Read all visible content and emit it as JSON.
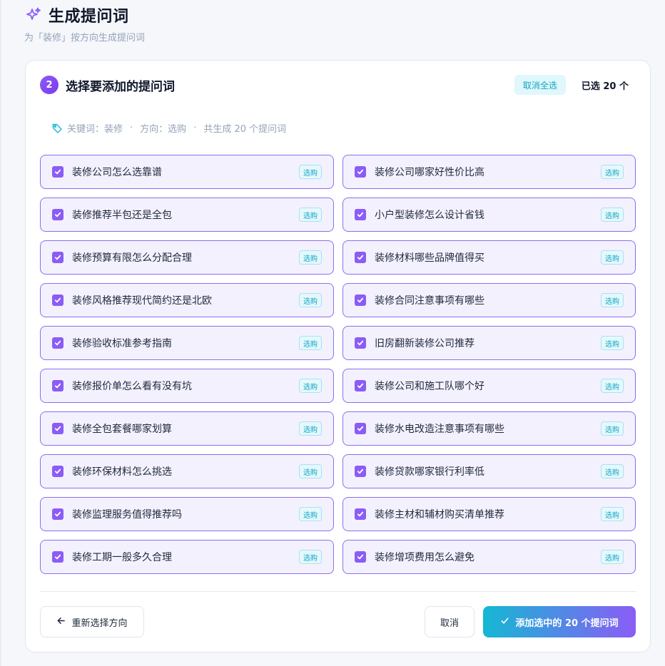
{
  "header": {
    "title": "生成提问词",
    "subtitle": "为「装修」按方向生成提问词"
  },
  "card": {
    "step_number": "2",
    "title": "选择要添加的提问词",
    "deselect_all_label": "取消全选",
    "selected_count": "已选 20 个",
    "meta": {
      "keyword": "关键词：装修",
      "direction": "方向：选购",
      "total": "共生成 20 个提问词",
      "separator": "·"
    }
  },
  "items": [
    {
      "text": "装修公司怎么选靠谱",
      "tag": "选购"
    },
    {
      "text": "装修公司哪家好性价比高",
      "tag": "选购"
    },
    {
      "text": "装修推荐半包还是全包",
      "tag": "选购"
    },
    {
      "text": "小户型装修怎么设计省钱",
      "tag": "选购"
    },
    {
      "text": "装修预算有限怎么分配合理",
      "tag": "选购"
    },
    {
      "text": "装修材料哪些品牌值得买",
      "tag": "选购"
    },
    {
      "text": "装修风格推荐现代简约还是北欧",
      "tag": "选购"
    },
    {
      "text": "装修合同注意事项有哪些",
      "tag": "选购"
    },
    {
      "text": "装修验收标准参考指南",
      "tag": "选购"
    },
    {
      "text": "旧房翻新装修公司推荐",
      "tag": "选购"
    },
    {
      "text": "装修报价单怎么看有没有坑",
      "tag": "选购"
    },
    {
      "text": "装修公司和施工队哪个好",
      "tag": "选购"
    },
    {
      "text": "装修全包套餐哪家划算",
      "tag": "选购"
    },
    {
      "text": "装修水电改造注意事项有哪些",
      "tag": "选购"
    },
    {
      "text": "装修环保材料怎么挑选",
      "tag": "选购"
    },
    {
      "text": "装修贷款哪家银行利率低",
      "tag": "选购"
    },
    {
      "text": "装修监理服务值得推荐吗",
      "tag": "选购"
    },
    {
      "text": "装修主材和辅材购买清单推荐",
      "tag": "选购"
    },
    {
      "text": "装修工期一般多久合理",
      "tag": "选购"
    },
    {
      "text": "装修增项费用怎么避免",
      "tag": "选购"
    }
  ],
  "footer": {
    "back_label": "重新选择方向",
    "cancel_label": "取消",
    "add_label": "添加选中的 20 个提问词"
  },
  "colors": {
    "accent_purple": "#8b5cf6",
    "accent_cyan": "#14b8d4",
    "item_border": "#8b6ef0",
    "item_bg": "#f4f1ff"
  },
  "icons": {
    "title": "sparkle-icon",
    "meta": "tag-icon",
    "item": "checkbox-checked-icon",
    "back": "arrow-left-icon",
    "add": "check-icon"
  }
}
